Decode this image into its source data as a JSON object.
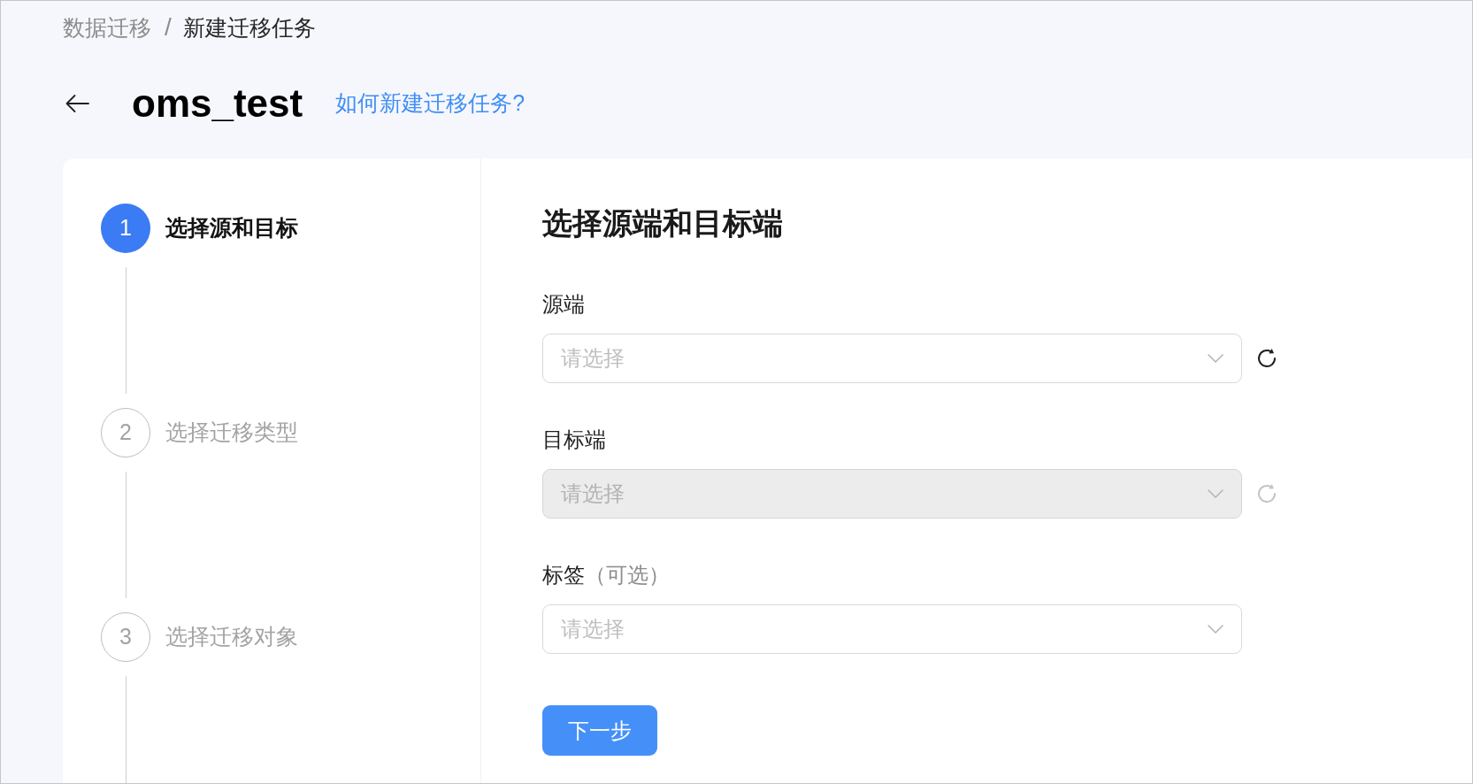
{
  "breadcrumb": {
    "separator": "/",
    "items": [
      {
        "label": "数据迁移",
        "current": false
      },
      {
        "label": "新建迁移任务",
        "current": true
      }
    ]
  },
  "header": {
    "title": "oms_test",
    "help_link": "如何新建迁移任务?"
  },
  "steps": [
    {
      "number": "1",
      "label": "选择源和目标",
      "selected": true
    },
    {
      "number": "2",
      "label": "选择迁移类型",
      "selected": false
    },
    {
      "number": "3",
      "label": "选择迁移对象",
      "selected": false
    }
  ],
  "form": {
    "heading": "选择源端和目标端",
    "fields": [
      {
        "label": "源端",
        "placeholder": "请选择",
        "disabled": false,
        "refresh": true
      },
      {
        "label": "目标端",
        "placeholder": "请选择",
        "disabled": true,
        "refresh": true
      },
      {
        "label": "标签",
        "note": "（可选）",
        "placeholder": "请选择",
        "disabled": false,
        "refresh": false
      }
    ],
    "submit": "下一步"
  }
}
